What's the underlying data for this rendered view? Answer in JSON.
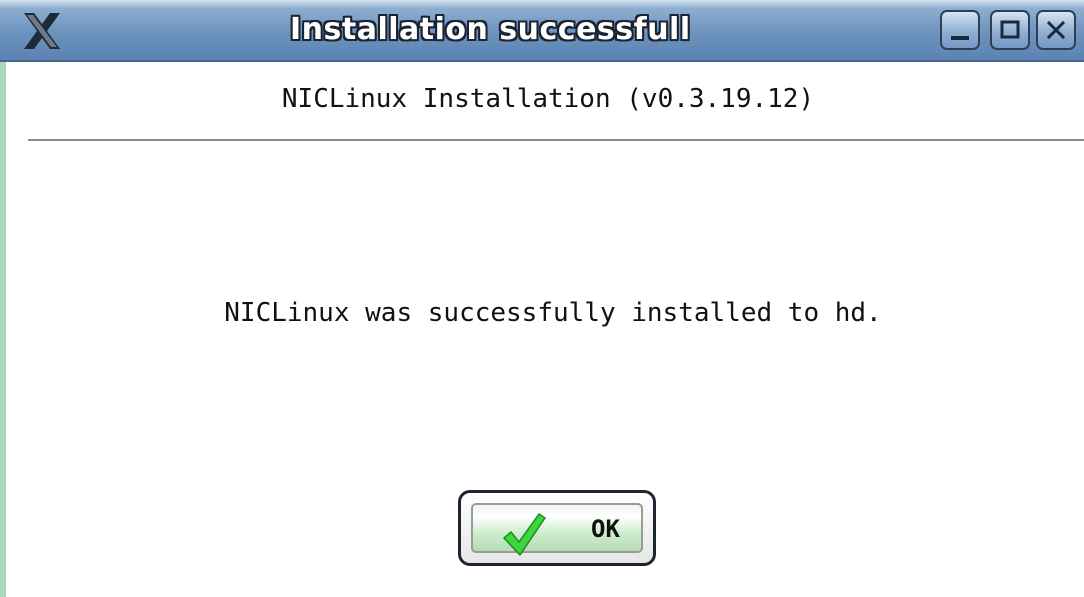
{
  "window": {
    "title": "Installation successfull",
    "logo_icon": "x-window-logo-icon",
    "controls": {
      "minimize_icon": "minimize-icon",
      "maximize_icon": "maximize-icon",
      "close_icon": "close-icon"
    },
    "colors": {
      "titlebar": "#6f94c0",
      "left_border": "#a9d7b9"
    }
  },
  "dialog": {
    "header": "NICLinux Installation (v0.3.19.12)",
    "message": "NICLinux was successfully installed to hd.",
    "ok_button": {
      "label": "OK",
      "icon": "checkmark-icon",
      "icon_color": "#3dd63d"
    }
  }
}
